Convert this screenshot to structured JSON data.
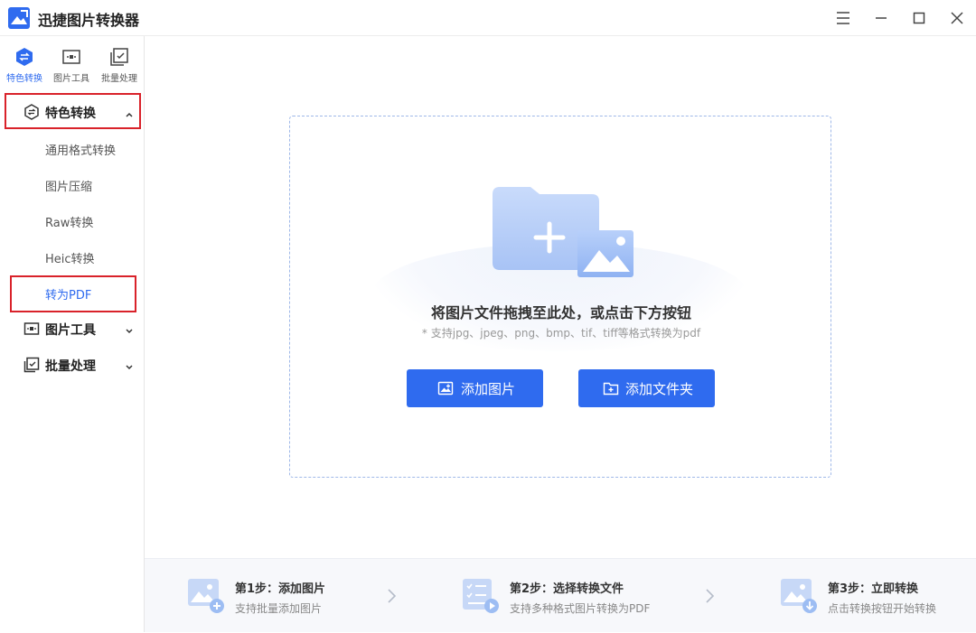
{
  "app": {
    "title": "迅捷图片转换器"
  },
  "top_nav": [
    {
      "label": "特色转换",
      "active": true
    },
    {
      "label": "图片工具",
      "active": false
    },
    {
      "label": "批量处理",
      "active": false
    }
  ],
  "sidebar": {
    "sections": [
      {
        "label": "特色转换",
        "expanded": true
      },
      {
        "label": "图片工具",
        "expanded": false
      },
      {
        "label": "批量处理",
        "expanded": false
      }
    ],
    "sub_items": [
      {
        "label": "通用格式转换",
        "active": false
      },
      {
        "label": "图片压缩",
        "active": false
      },
      {
        "label": "Raw转换",
        "active": false
      },
      {
        "label": "Heic转换",
        "active": false
      },
      {
        "label": "转为PDF",
        "active": true
      }
    ]
  },
  "dropzone": {
    "title": "将图片文件拖拽至此处，或点击下方按钮",
    "hint": "* 支持jpg、jpeg、png、bmp、tif、tiff等格式转换为pdf",
    "add_image_label": "添加图片",
    "add_folder_label": "添加文件夹"
  },
  "steps": [
    {
      "title": "第1步：添加图片",
      "desc": "支持批量添加图片"
    },
    {
      "title": "第2步：选择转换文件",
      "desc": "支持多种格式图片转换为PDF"
    },
    {
      "title": "第3步：立即转换",
      "desc": "点击转换按钮开始转换"
    }
  ],
  "colors": {
    "accent": "#2f6bef",
    "highlight_box": "#d9222a"
  },
  "icons": {
    "logo": "app-logo-icon",
    "window": [
      "menu-icon",
      "minimize-icon",
      "maximize-icon",
      "close-icon"
    ]
  }
}
